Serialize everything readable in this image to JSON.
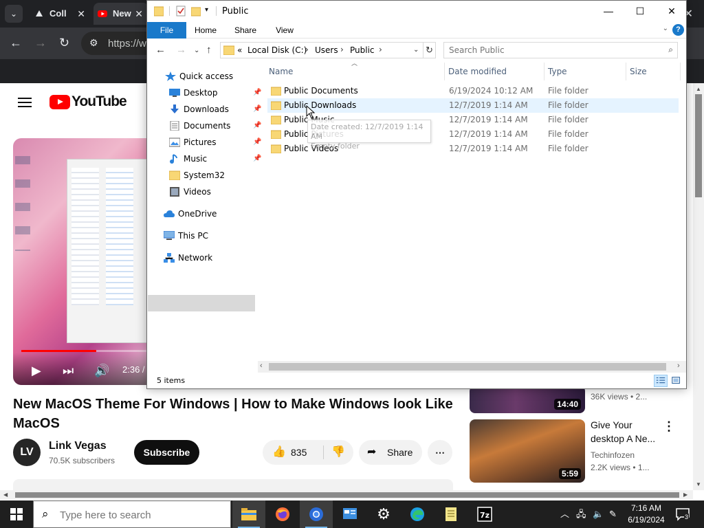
{
  "browser": {
    "tabs": [
      {
        "label": "Coll"
      },
      {
        "label": "New"
      }
    ],
    "address": {
      "url": "https://w"
    }
  },
  "youtube": {
    "logo_text": "YouTube",
    "player": {
      "time": "2:36 /",
      "progress_fraction": 0.6
    },
    "video_title": "New MacOS Theme For Windows | How to Make Windows look Like MacOS",
    "channel": {
      "name": "Link Vegas",
      "subscribers": "70.5K subscribers",
      "avatar_initials": "LV"
    },
    "subscribe_label": "Subscribe",
    "likes": "835",
    "share_label": "Share",
    "more_label": "⋯",
    "sidebar": [
      {
        "duration": "14:40",
        "views": "36K views • 2..."
      },
      {
        "duration": "5:59",
        "title": "Give Your desktop A Ne...",
        "channel": "Techinfozen",
        "views": "2.2K views • 1..."
      }
    ]
  },
  "explorer": {
    "title": "Public",
    "ribbon_tabs": [
      "File",
      "Home",
      "Share",
      "View"
    ],
    "address": {
      "prefix": "«",
      "segments": [
        "Local Disk (C:)",
        "Users",
        "Public"
      ]
    },
    "search_placeholder": "Search Public",
    "nav": [
      {
        "label": "Quick access",
        "icon": "star-icon"
      },
      {
        "label": "Desktop",
        "icon": "desktop-icon",
        "pinned": true
      },
      {
        "label": "Downloads",
        "icon": "download-icon",
        "pinned": true
      },
      {
        "label": "Documents",
        "icon": "documents-icon",
        "pinned": true
      },
      {
        "label": "Pictures",
        "icon": "pictures-icon",
        "pinned": true
      },
      {
        "label": "Music",
        "icon": "music-icon",
        "pinned": true
      },
      {
        "label": "System32",
        "icon": "folder-icon"
      },
      {
        "label": "Videos",
        "icon": "videos-icon"
      },
      {
        "label": "OneDrive",
        "icon": "cloud-icon"
      },
      {
        "label": "This PC",
        "icon": "pc-icon",
        "selected": true
      },
      {
        "label": "Network",
        "icon": "network-icon"
      }
    ],
    "columns": [
      "Name",
      "Date modified",
      "Type",
      "Size"
    ],
    "files": [
      {
        "name": "Public Documents",
        "date": "6/19/2024 10:12 AM",
        "type": "File folder"
      },
      {
        "name": "Public Downloads",
        "date": "12/7/2019 1:14 AM",
        "type": "File folder",
        "hover": true
      },
      {
        "name": "Public Music",
        "date": "12/7/2019 1:14 AM",
        "type": "File folder"
      },
      {
        "name": "Public Pictures",
        "date": "12/7/2019 1:14 AM",
        "type": "File folder"
      },
      {
        "name": "Public Videos",
        "date": "12/7/2019 1:14 AM",
        "type": "File folder"
      }
    ],
    "tooltip": {
      "line1": "Date created: 12/7/2019 1:14 AM",
      "line2": "Empty folder"
    },
    "status": "5 items"
  },
  "taskbar": {
    "search_placeholder": "Type here to search",
    "time": "7:16 AM",
    "date": "6/19/2024",
    "notification_count": "3",
    "colors": {
      "bg": "#1f1f1f",
      "accent": "#76b9ed"
    }
  }
}
